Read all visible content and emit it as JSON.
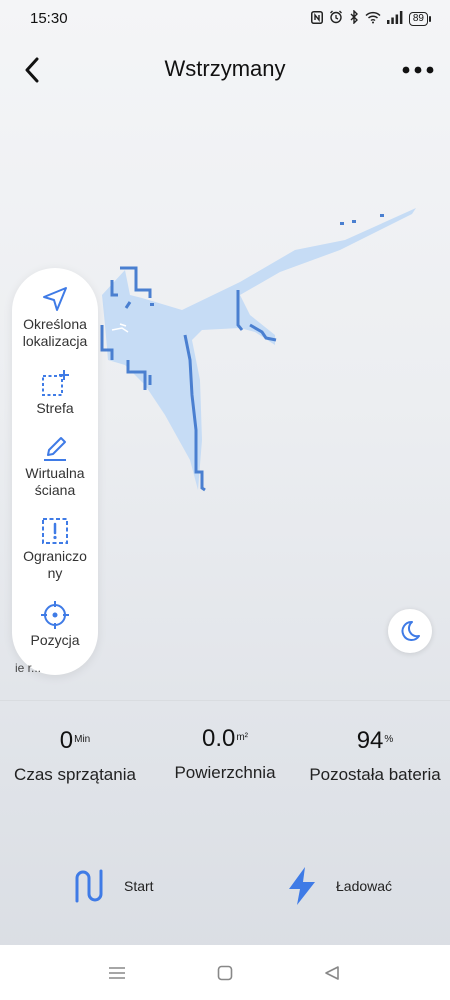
{
  "status": {
    "time": "15:30",
    "icons": [
      "nfc-icon",
      "alarm-icon",
      "bluetooth-icon",
      "wifi-icon",
      "signal-icon"
    ],
    "battery": "89"
  },
  "header": {
    "title": "Wstrzymany",
    "back_icon": "chevron-left-icon",
    "more_icon": "more-horizontal-icon"
  },
  "tools": [
    {
      "id": "location",
      "icon": "navigation-arrow-icon",
      "label_lines": [
        "Określona",
        "lokalizacja"
      ]
    },
    {
      "id": "zone",
      "icon": "zone-add-icon",
      "label_lines": [
        "Strefa"
      ]
    },
    {
      "id": "virtual-wall",
      "icon": "pen-icon",
      "label_lines": [
        "Wirtualna",
        "ściana"
      ]
    },
    {
      "id": "restricted",
      "icon": "restricted-zone-icon",
      "label_lines": [
        "Ograniczo",
        "ny"
      ]
    },
    {
      "id": "position",
      "icon": "crosshair-icon",
      "label_lines": [
        "Pozycja"
      ]
    }
  ],
  "cut_label": "ie r...",
  "moon_icon": "moon-icon",
  "stats": [
    {
      "value": "0",
      "unit": "Min",
      "label": "Czas sprzątania"
    },
    {
      "value": "0.0",
      "unit": "m²",
      "label": "Powierzchnia"
    },
    {
      "value": "94",
      "unit": "%",
      "label": "Pozostała bateria"
    }
  ],
  "actions": {
    "start": {
      "label": "Start",
      "icon": "route-icon"
    },
    "charge": {
      "label": "Ładować",
      "icon": "lightning-icon"
    }
  },
  "colors": {
    "accent": "#3f7be6",
    "map_fill": "#c6dcf5",
    "map_wall": "#4a7fd0"
  },
  "nav": [
    "menu-icon",
    "home-icon",
    "back-triangle-icon"
  ]
}
